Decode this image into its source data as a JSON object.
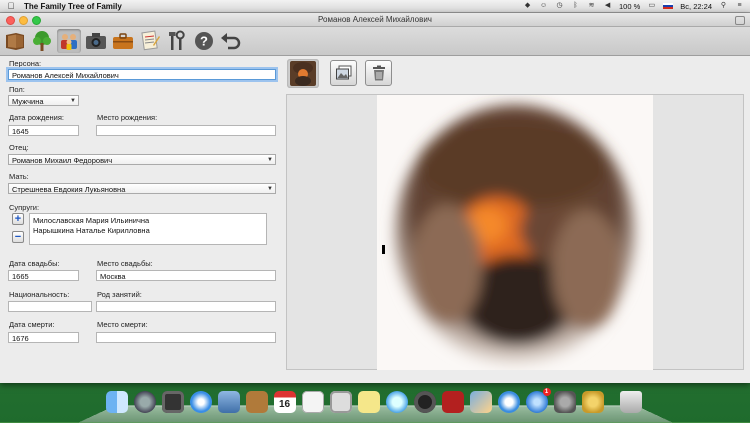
{
  "menubar": {
    "app_name": "The Family Tree of Family",
    "battery": "100 %",
    "clock": "Вс, 22:24"
  },
  "window": {
    "title": "Романов Алексей Михайлович"
  },
  "toolbar": {
    "icons": [
      "book-icon",
      "tree-icon",
      "people-icon",
      "camera-icon",
      "briefcase-icon",
      "notes-icon",
      "tools-icon",
      "help-icon",
      "undo-icon"
    ],
    "selected": "people-icon"
  },
  "form": {
    "person_label": "Персона:",
    "person_value": "Романов Алексей Михайлович",
    "gender_label": "Пол:",
    "gender_value": "Мужчина",
    "birth_date_label": "Дата рождения:",
    "birth_date_value": "1645",
    "birth_place_label": "Место рождения:",
    "birth_place_value": "",
    "father_label": "Отец:",
    "father_value": "Романов Михаил Федорович",
    "mother_label": "Мать:",
    "mother_value": "Стрешнева Евдокия Лукьяновна",
    "spouses_label": "Супруги:",
    "spouses": [
      "Милославская Мария Ильинична",
      "Нарышкина Наталье Кирилловна"
    ],
    "add_label": "+",
    "remove_label": "−",
    "wedding_date_label": "Дата свадьбы:",
    "wedding_date_value": "1665",
    "wedding_place_label": "Место свадьбы:",
    "wedding_place_value": "Москва",
    "nationality_label": "Национальность:",
    "nationality_value": "",
    "occupation_label": "Род занятий:",
    "occupation_value": "",
    "death_date_label": "Дата смерти:",
    "death_date_value": "1676",
    "death_place_label": "Место смерти:",
    "death_place_value": ""
  },
  "colors": {
    "accent_focus": "#5a9ad8",
    "desktop": "#2e7a36"
  },
  "dock": {
    "icons": [
      "finder-icon",
      "launchpad-icon",
      "mission-control-icon",
      "safari-icon",
      "mail-stamp-icon",
      "contacts-icon",
      "calendar-icon",
      "reminders-icon",
      "notes-icon",
      "stickies-icon",
      "messages-icon",
      "facetime-icon",
      "photo-booth-icon",
      "iphoto-icon",
      "itunes-icon",
      "app-store-icon",
      "system-preferences-icon",
      "family-tree-icon",
      "trash-icon"
    ],
    "calendar_day": "16",
    "appstore_badge": "1"
  }
}
